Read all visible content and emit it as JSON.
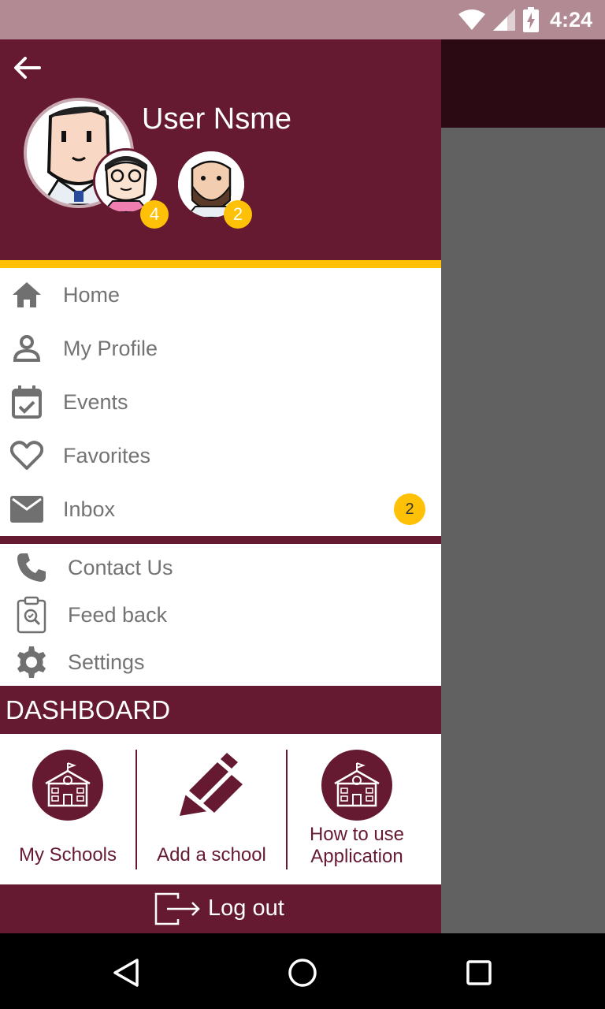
{
  "status_bar": {
    "time": "4:24",
    "icons": [
      "wifi-icon",
      "cellular-icon",
      "battery-charging-icon"
    ]
  },
  "header": {
    "user_name": "User Nsme",
    "badges": {
      "first": "4",
      "second": "2"
    },
    "colors": {
      "primary": "#661a31",
      "accent": "#ffc107"
    }
  },
  "menu": {
    "items": [
      {
        "label": "Home",
        "icon": "home-icon"
      },
      {
        "label": "My Profile",
        "icon": "person-icon"
      },
      {
        "label": "Events",
        "icon": "calendar-check-icon"
      },
      {
        "label": "Favorites",
        "icon": "heart-icon"
      },
      {
        "label": "Inbox",
        "icon": "mail-icon",
        "badge": "2"
      }
    ]
  },
  "secondary_menu": {
    "items": [
      {
        "label": "Contact Us",
        "icon": "phone-icon"
      },
      {
        "label": "Feed back",
        "icon": "clipboard-search-icon"
      },
      {
        "label": "Settings",
        "icon": "gear-icon"
      }
    ]
  },
  "dashboard": {
    "title": "DASHBOARD",
    "tiles": [
      {
        "label": "My Schools",
        "icon": "school-icon"
      },
      {
        "label": "Add a school",
        "icon": "pencil-icon"
      },
      {
        "label_line1": "How to use",
        "label_line2": "Application",
        "icon": "school-icon"
      }
    ]
  },
  "logout": {
    "label": "Log out",
    "icon": "logout-icon"
  }
}
